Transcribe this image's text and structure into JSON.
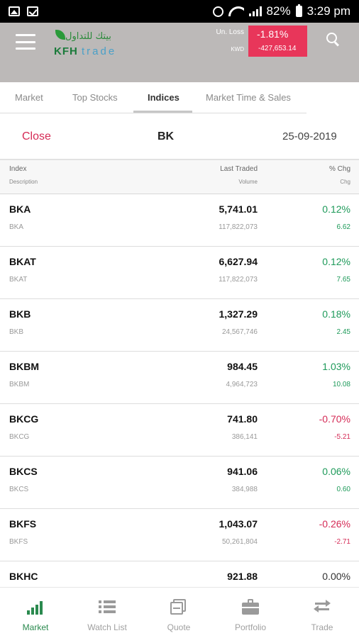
{
  "status_bar": {
    "battery": "82%",
    "time": "3:29 pm",
    "icons": [
      "gallery-icon",
      "checkbox-icon",
      "alarm-icon",
      "wifi-icon",
      "signal-icon",
      "battery-icon"
    ]
  },
  "header": {
    "logo_arabic": "بيتك للتداول",
    "logo_brand": "KFH",
    "logo_suffix": "trade",
    "unrealized_label": "Un. Loss",
    "unrealized_pct": "-1.81%",
    "currency_label": "KWD",
    "unrealized_amount": "-427,653.14",
    "loss_color": "#e8365a"
  },
  "tabs": [
    {
      "label": "Market",
      "active": false
    },
    {
      "label": "Top Stocks",
      "active": false
    },
    {
      "label": "Indices",
      "active": true
    },
    {
      "label": "Market Time & Sales",
      "active": false
    }
  ],
  "subheader": {
    "close_label": "Close",
    "market": "BK",
    "date": "25-09-2019"
  },
  "columns": {
    "index": "Index",
    "description": "Description",
    "last_traded": "Last Traded",
    "volume": "Volume",
    "pct_chg": "% Chg",
    "chg": "Chg"
  },
  "colors": {
    "positive": "#1e9a5a",
    "negative": "#d52b56",
    "neutral": "#333333",
    "accent": "#2b8a4f"
  },
  "rows": [
    {
      "name": "BKA",
      "desc": "BKA",
      "last": "5,741.01",
      "volume": "117,822,073",
      "pct": "0.12%",
      "chg": "6.62",
      "trend": "positive"
    },
    {
      "name": "BKAT",
      "desc": "BKAT",
      "last": "6,627.94",
      "volume": "117,822,073",
      "pct": "0.12%",
      "chg": "7.65",
      "trend": "positive"
    },
    {
      "name": "BKB",
      "desc": "BKB",
      "last": "1,327.29",
      "volume": "24,567,746",
      "pct": "0.18%",
      "chg": "2.45",
      "trend": "positive"
    },
    {
      "name": "BKBM",
      "desc": "BKBM",
      "last": "984.45",
      "volume": "4,964,723",
      "pct": "1.03%",
      "chg": "10.08",
      "trend": "positive"
    },
    {
      "name": "BKCG",
      "desc": "BKCG",
      "last": "741.80",
      "volume": "386,141",
      "pct": "-0.70%",
      "chg": "-5.21",
      "trend": "negative"
    },
    {
      "name": "BKCS",
      "desc": "BKCS",
      "last": "941.06",
      "volume": "384,988",
      "pct": "0.06%",
      "chg": "0.60",
      "trend": "positive"
    },
    {
      "name": "BKFS",
      "desc": "BKFS",
      "last": "1,043.07",
      "volume": "50,261,804",
      "pct": "-0.26%",
      "chg": "-2.71",
      "trend": "negative"
    },
    {
      "name": "BKHC",
      "desc": "",
      "last": "921.88",
      "volume": "",
      "pct": "0.00%",
      "chg": "",
      "trend": "neutral"
    }
  ],
  "bottom_nav": [
    {
      "label": "Market",
      "icon": "bar-chart-icon",
      "active": true
    },
    {
      "label": "Watch List",
      "icon": "list-icon",
      "active": false
    },
    {
      "label": "Quote",
      "icon": "quote-icon",
      "active": false
    },
    {
      "label": "Portfolio",
      "icon": "briefcase-icon",
      "active": false
    },
    {
      "label": "Trade",
      "icon": "exchange-arrows-icon",
      "active": false
    }
  ]
}
